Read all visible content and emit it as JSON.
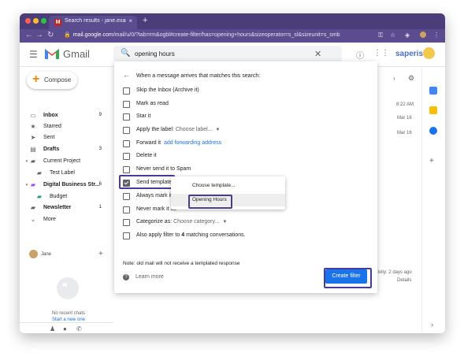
{
  "browser": {
    "tab_title": "Search results - jane.example",
    "tab_favicon": "M",
    "tab_close": "×",
    "new_tab": "+",
    "url_host": "mail.google.com",
    "url_path": "/mail/u/0/?tab=rm&ogbl#create-filter/has=opening+hours&sizeoperator=s_sl&sizeunit=s_smb"
  },
  "gmail": {
    "app_name": "Gmail",
    "search_query": "opening hours",
    "brand": "saperis"
  },
  "sidebar": {
    "compose_label": "Compose",
    "items": [
      {
        "label": "Inbox",
        "count": "9",
        "icon": "inbox-icon",
        "glyph": "▭",
        "bold": true
      },
      {
        "label": "Starred",
        "count": "",
        "icon": "star-icon",
        "glyph": "★",
        "bold": false
      },
      {
        "label": "Sent",
        "count": "",
        "icon": "send-icon",
        "glyph": "➤",
        "bold": false
      },
      {
        "label": "Drafts",
        "count": "3",
        "icon": "draft-icon",
        "glyph": "▤",
        "bold": true
      },
      {
        "label": "Current Project",
        "count": "",
        "icon": "label-icon",
        "glyph": "▰",
        "bold": false
      },
      {
        "label": "Test Label",
        "count": "",
        "icon": "label-icon",
        "glyph": "▰",
        "bold": false
      },
      {
        "label": "Digital Business Str...",
        "count": "6",
        "icon": "label-icon",
        "glyph": "▰",
        "bold": true
      },
      {
        "label": "Budget",
        "count": "",
        "icon": "label-icon",
        "glyph": "▰",
        "bold": false
      },
      {
        "label": "Newsletter",
        "count": "1",
        "icon": "label-icon",
        "glyph": "▰",
        "bold": true
      },
      {
        "label": "More",
        "count": "",
        "icon": "chevron-down-icon",
        "glyph": "⌄",
        "bold": false
      }
    ],
    "chat_user": "Jane",
    "no_chats": "No recent chats",
    "start_chat": "Start a new one"
  },
  "background": {
    "times": [
      "8:22 AM",
      "Mar 16",
      "Mar 16"
    ],
    "activity": "tivity: 2 days ago",
    "details": "Details"
  },
  "filter_dialog": {
    "header": "When a message arrives that matches this search:",
    "options": [
      {
        "label": "Skip the Inbox (Archive it)",
        "checked": false
      },
      {
        "label": "Mark as read",
        "checked": false
      },
      {
        "label": "Star it",
        "checked": false
      },
      {
        "label": "Apply the label:",
        "checked": false,
        "select": "Choose label..."
      },
      {
        "label": "Forward it",
        "checked": false,
        "link": "add forwarding address"
      },
      {
        "label": "Delete it",
        "checked": false
      },
      {
        "label": "Never send it to Spam",
        "checked": false
      },
      {
        "label": "Send template:",
        "checked": true
      },
      {
        "label": "Always mark it a",
        "checked": false
      },
      {
        "label": "Never mark it as",
        "checked": false
      },
      {
        "label": "Categorize as:",
        "checked": false,
        "select": "Choose category..."
      },
      {
        "label": "Also apply filter to",
        "checked": false,
        "count": "4",
        "suffix": "matching conversations."
      }
    ],
    "note": "Note: old mail will not receive a templated response",
    "learn_more": "Learn more",
    "create_button": "Create filter"
  },
  "template_dropdown": {
    "options": [
      "Choose template...",
      "Opening Hours"
    ],
    "highlighted": "Opening Hours"
  },
  "colors": {
    "browser_chrome": "#4a3d79",
    "accent_blue": "#1a73e8",
    "highlight_border": "#4a3a9b"
  }
}
